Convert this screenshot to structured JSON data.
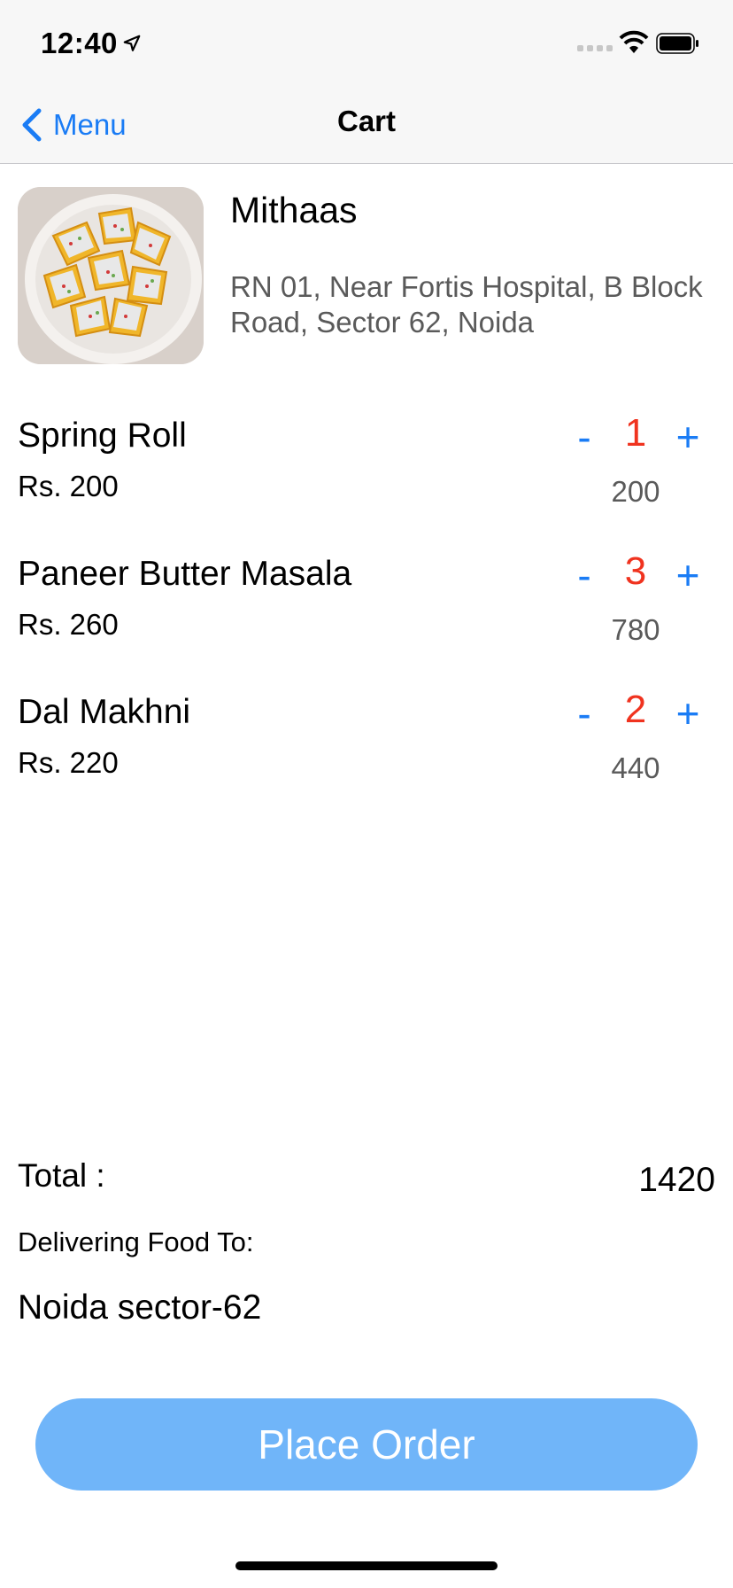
{
  "status": {
    "time": "12:40"
  },
  "nav": {
    "back_label": "Menu",
    "title": "Cart"
  },
  "restaurant": {
    "name": "Mithaas",
    "address": "RN 01, Near Fortis Hospital, B Block Road, Sector 62, Noida"
  },
  "items": [
    {
      "name": "Spring Roll",
      "price": "Rs. 200",
      "qty": "1",
      "subtotal": "200"
    },
    {
      "name": "Paneer Butter Masala",
      "price": "Rs. 260",
      "qty": "3",
      "subtotal": "780"
    },
    {
      "name": "Dal Makhni",
      "price": "Rs. 220",
      "qty": "2",
      "subtotal": "440"
    }
  ],
  "controls": {
    "minus": "-",
    "plus": "+"
  },
  "summary": {
    "total_label": "Total :",
    "total_value": "1420",
    "delivery_label": "Delivering Food To:",
    "delivery_address": "Noida sector-62"
  },
  "action": {
    "place_order": "Place Order"
  },
  "colors": {
    "accent": "#1a7cf5",
    "qty": "#f0331f",
    "button": "#70b5f9"
  }
}
